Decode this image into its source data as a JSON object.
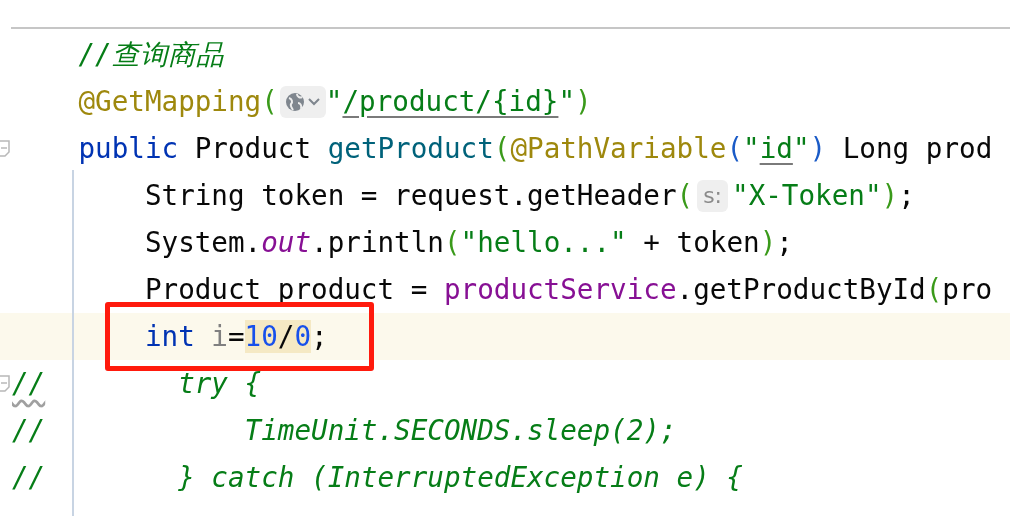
{
  "editor": {
    "lines": [
      {
        "fold": false,
        "caret": false,
        "boxed": false,
        "tokens": [
          {
            "text": "    //查询商品",
            "kind": "comment"
          }
        ]
      },
      {
        "fold": false,
        "caret": false,
        "boxed": false,
        "tokens": [
          {
            "text": "    @GetMapping",
            "kind": "annotation"
          },
          {
            "text": "(",
            "kind": "bracket-green"
          },
          {
            "kind": "globe-inlay"
          },
          {
            "text": "\"",
            "kind": "string"
          },
          {
            "text": "/product/{id}",
            "kind": "string",
            "underline": true
          },
          {
            "text": "\"",
            "kind": "string"
          },
          {
            "text": ")",
            "kind": "bracket-green"
          }
        ]
      },
      {
        "fold": true,
        "caret": false,
        "boxed": false,
        "tokens": [
          {
            "text": "    public ",
            "kind": "keyword"
          },
          {
            "text": "Product ",
            "kind": "plain"
          },
          {
            "text": "getProduct",
            "kind": "method"
          },
          {
            "text": "(",
            "kind": "bracket-green"
          },
          {
            "text": "@PathVariable",
            "kind": "annotation"
          },
          {
            "text": "(",
            "kind": "bracket-blue"
          },
          {
            "text": "\"",
            "kind": "string"
          },
          {
            "text": "id",
            "kind": "string",
            "underline": true
          },
          {
            "text": "\"",
            "kind": "string"
          },
          {
            "text": ")",
            "kind": "bracket-blue"
          },
          {
            "text": " Long prod",
            "kind": "plain"
          }
        ]
      },
      {
        "fold": false,
        "caret": false,
        "boxed": false,
        "tokens": [
          {
            "text": "        String token = request.getHeader",
            "kind": "plain"
          },
          {
            "text": "(",
            "kind": "bracket-green"
          },
          {
            "text": "s:",
            "kind": "parameter-hint"
          },
          {
            "text": "\"X-Token\"",
            "kind": "string"
          },
          {
            "text": ")",
            "kind": "bracket-green"
          },
          {
            "text": ";",
            "kind": "plain"
          }
        ]
      },
      {
        "fold": false,
        "caret": false,
        "boxed": false,
        "tokens": [
          {
            "text": "        System.",
            "kind": "plain"
          },
          {
            "text": "out",
            "kind": "static-field"
          },
          {
            "text": ".println",
            "kind": "plain"
          },
          {
            "text": "(",
            "kind": "bracket-green"
          },
          {
            "text": "\"hello...\"",
            "kind": "string"
          },
          {
            "text": " + token",
            "kind": "plain"
          },
          {
            "text": ")",
            "kind": "bracket-green"
          },
          {
            "text": ";",
            "kind": "plain"
          }
        ]
      },
      {
        "fold": false,
        "caret": false,
        "boxed": false,
        "tokens": [
          {
            "text": "        Product product = ",
            "kind": "plain"
          },
          {
            "text": "productService",
            "kind": "field"
          },
          {
            "text": ".getProductById",
            "kind": "plain"
          },
          {
            "text": "(",
            "kind": "bracket-green"
          },
          {
            "text": "pro",
            "kind": "plain"
          }
        ]
      },
      {
        "fold": false,
        "caret": true,
        "boxed": true,
        "tokens": [
          {
            "text": "        int ",
            "kind": "keyword"
          },
          {
            "text": "i",
            "kind": "unused"
          },
          {
            "text": "=",
            "kind": "plain"
          },
          {
            "text": "10",
            "kind": "number",
            "match": true
          },
          {
            "text": "/",
            "kind": "plain",
            "match": true
          },
          {
            "text": "0",
            "kind": "number",
            "match": true
          },
          {
            "text": ";",
            "kind": "plain"
          }
        ]
      },
      {
        "fold": true,
        "caret": false,
        "boxed": false,
        "tokens": [
          {
            "text": "//",
            "kind": "comment-plain",
            "squiggle": true
          },
          {
            "text": "        try {",
            "kind": "comment-plain"
          }
        ]
      },
      {
        "fold": false,
        "caret": false,
        "boxed": false,
        "tokens": [
          {
            "text": "//            TimeUnit.SECONDS.sleep(2);",
            "kind": "comment-plain"
          }
        ]
      },
      {
        "fold": false,
        "caret": false,
        "boxed": false,
        "tokens": [
          {
            "text": "//        } catch (InterruptedException e) {",
            "kind": "comment-plain"
          }
        ]
      }
    ]
  }
}
